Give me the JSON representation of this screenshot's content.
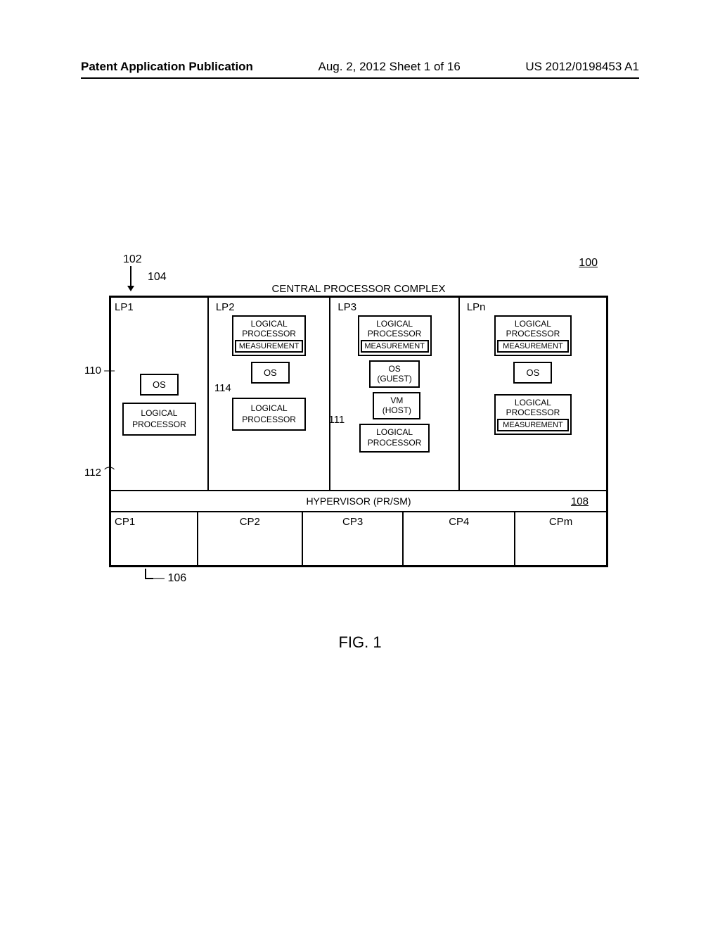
{
  "header": {
    "left": "Patent Application Publication",
    "center": "Aug. 2, 2012  Sheet 1 of 16",
    "right": "US 2012/0198453 A1"
  },
  "refs": {
    "r100": "100",
    "r102": "102",
    "r104": "104",
    "r106": "106",
    "r108": "108",
    "r110": "110",
    "r111": "111",
    "r112": "112",
    "r114": "114"
  },
  "title_cpc": "CENTRAL PROCESSOR COMPLEX",
  "lp": {
    "lp1": "LP1",
    "lp2": "LP2",
    "lp3": "LP3",
    "lpn": "LPn"
  },
  "labels": {
    "logical_processor": "LOGICAL PROCESSOR",
    "measurement": "MEASUREMENT",
    "os": "OS",
    "os_guest": "OS (GUEST)",
    "vm_host": "VM (HOST)"
  },
  "hypervisor": "HYPERVISOR (PR/SM)",
  "cp": {
    "cp1": "CP1",
    "cp2": "CP2",
    "cp3": "CP3",
    "cp4": "CP4",
    "cpm": "CPm"
  },
  "figure": "FIG. 1"
}
